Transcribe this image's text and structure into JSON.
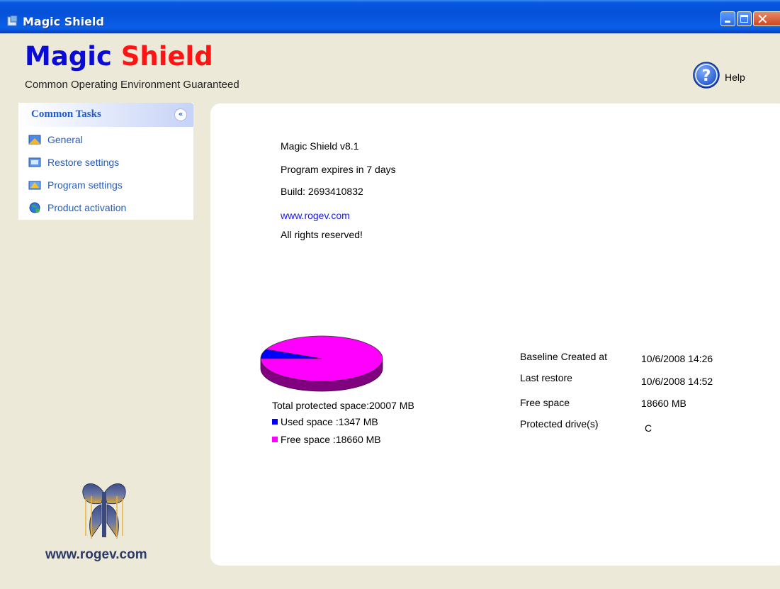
{
  "window": {
    "title": "Magic Shield",
    "controls": [
      "minimize",
      "maximize",
      "close"
    ]
  },
  "header": {
    "brand_part1": "Magic",
    "brand_part2": "Shield",
    "tagline": "Common Operating Environment Guaranteed",
    "help_label": "Help",
    "help_icon": "question-mark-circle-icon"
  },
  "sidebar": {
    "title": "Common Tasks",
    "items": [
      {
        "label": "General",
        "icon": "general-icon"
      },
      {
        "label": "Restore settings",
        "icon": "restore-icon"
      },
      {
        "label": "Program settings",
        "icon": "program-settings-icon"
      },
      {
        "label": "Product activation",
        "icon": "globe-activation-icon"
      }
    ],
    "footer_url": "www.rogev.com"
  },
  "about": {
    "version": "Magic Shield v8.1",
    "expiry": "Program expires in 7 days",
    "build": "Build:  2693410832",
    "website": "www.rogev.com",
    "rights": "All rights reserved!"
  },
  "space": {
    "total": "Total protected space:20007 MB",
    "used": "Used space   :1347 MB",
    "free": "Free space   :18660 MB"
  },
  "status": {
    "rows": [
      {
        "label": "Baseline Created at",
        "value": "10/6/2008 14:26"
      },
      {
        "label": "Last restore",
        "value": "10/6/2008 14:52"
      },
      {
        "label": "Free space",
        "value": "18660 MB"
      },
      {
        "label": "Protected drive(s)",
        "value": "C"
      }
    ]
  },
  "chart_data": {
    "type": "pie",
    "title": "",
    "series": [
      {
        "name": "Used space",
        "value": 1347,
        "color": "#0000ff"
      },
      {
        "name": "Free space",
        "value": 18660,
        "color": "#ff00ff"
      }
    ],
    "total": 20007,
    "unit": "MB"
  }
}
